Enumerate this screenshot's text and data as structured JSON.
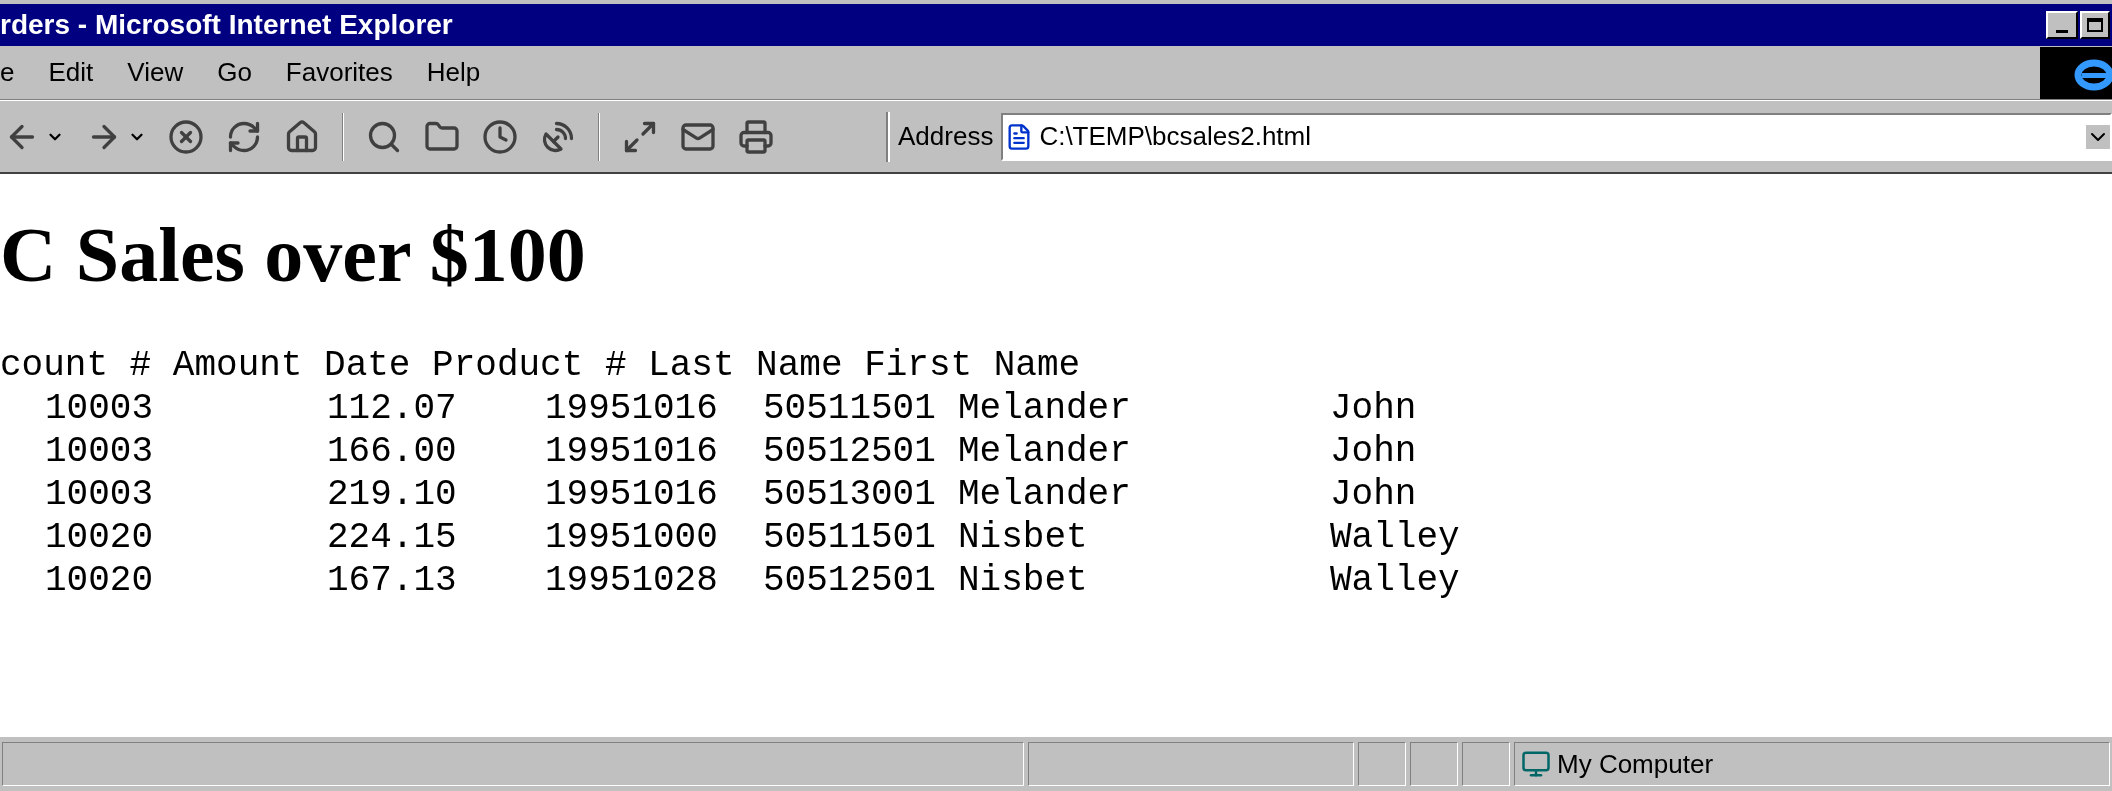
{
  "window": {
    "title": "rders - Microsoft Internet Explorer"
  },
  "menu": [
    "e",
    "Edit",
    "View",
    "Go",
    "Favorites",
    "Help"
  ],
  "address": {
    "label": "Address",
    "value": "C:\\TEMP\\bcsales2.html"
  },
  "page": {
    "heading": "C Sales over $100",
    "header_line": "count # Amount Date Product # Last Name First Name",
    "rows": [
      {
        "cells": [
          "10003",
          "112.07",
          "19951016",
          "50511501",
          "Melander",
          "John"
        ]
      },
      {
        "cells": [
          "10003",
          "166.00",
          "19951016",
          "50512501",
          "Melander",
          "John"
        ]
      },
      {
        "cells": [
          "10003",
          "219.10",
          "19951016",
          "50513001",
          "Melander",
          "John"
        ]
      },
      {
        "cells": [
          "10020",
          "224.15",
          "19951000",
          "50511501",
          "Nisbet",
          "Walley"
        ]
      },
      {
        "cells": [
          "10020",
          "167.13",
          "19951028",
          "50512501",
          "Nisbet",
          "Walley"
        ]
      }
    ]
  },
  "status_bar": {
    "zone": "My Computer"
  }
}
